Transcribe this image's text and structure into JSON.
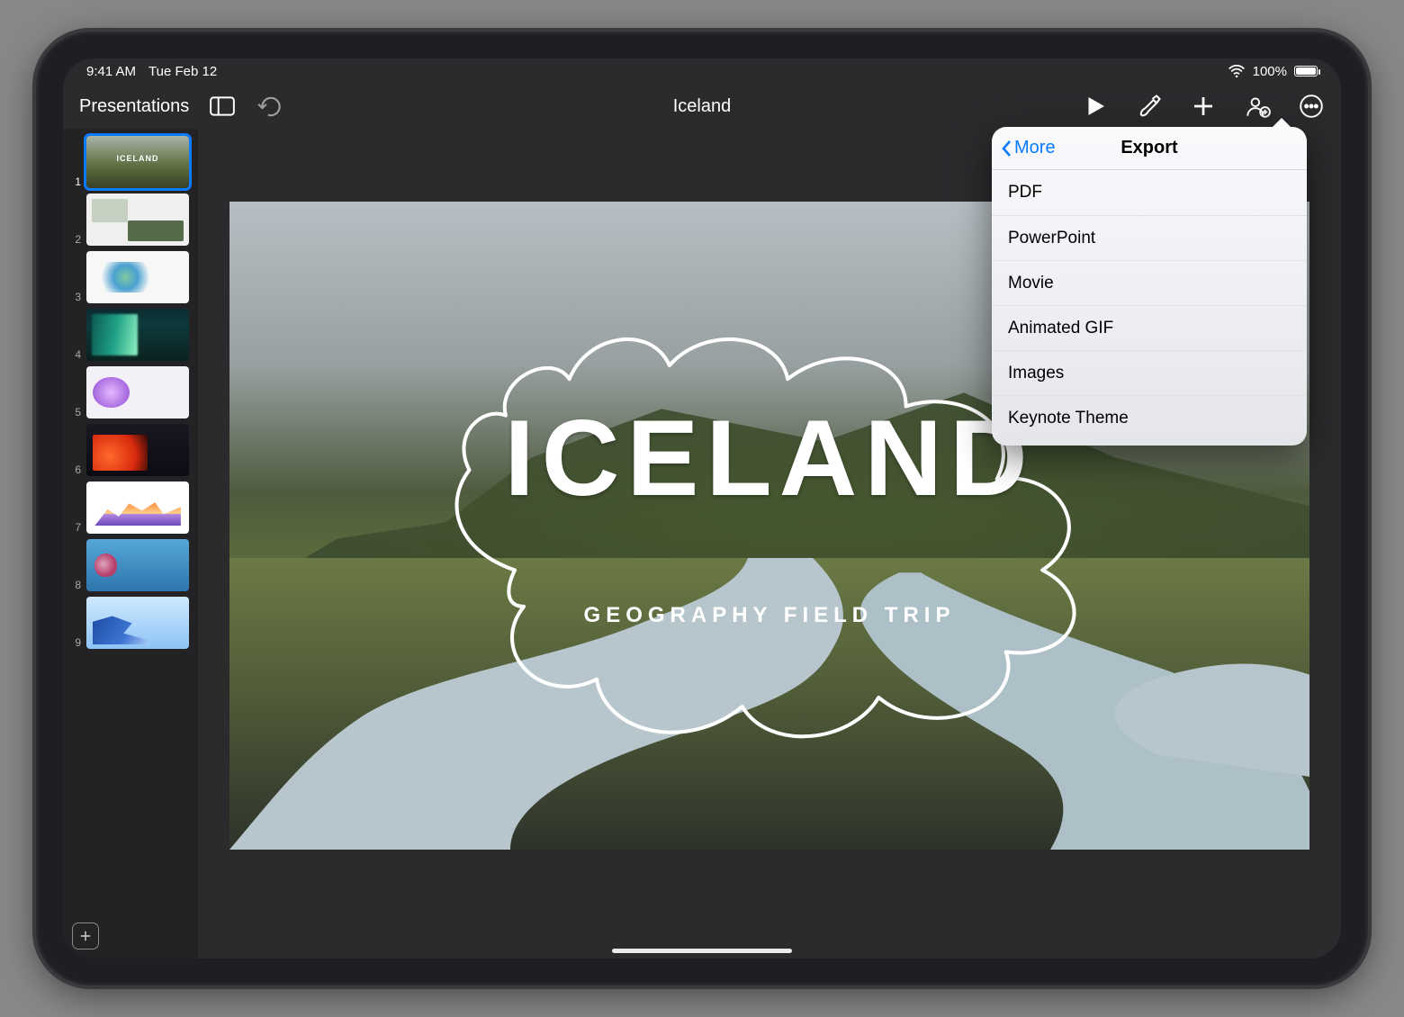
{
  "status": {
    "time": "9:41 AM",
    "date": "Tue Feb 12",
    "battery_text": "100%"
  },
  "toolbar": {
    "back_label": "Presentations",
    "document_title": "Iceland"
  },
  "sidebar": {
    "slide_count": 9,
    "selected_index": 1
  },
  "slide": {
    "title": "ICELAND",
    "subtitle": "GEOGRAPHY FIELD TRIP"
  },
  "popover": {
    "back_label": "More",
    "title": "Export",
    "items": [
      "PDF",
      "PowerPoint",
      "Movie",
      "Animated GIF",
      "Images",
      "Keynote Theme"
    ]
  }
}
